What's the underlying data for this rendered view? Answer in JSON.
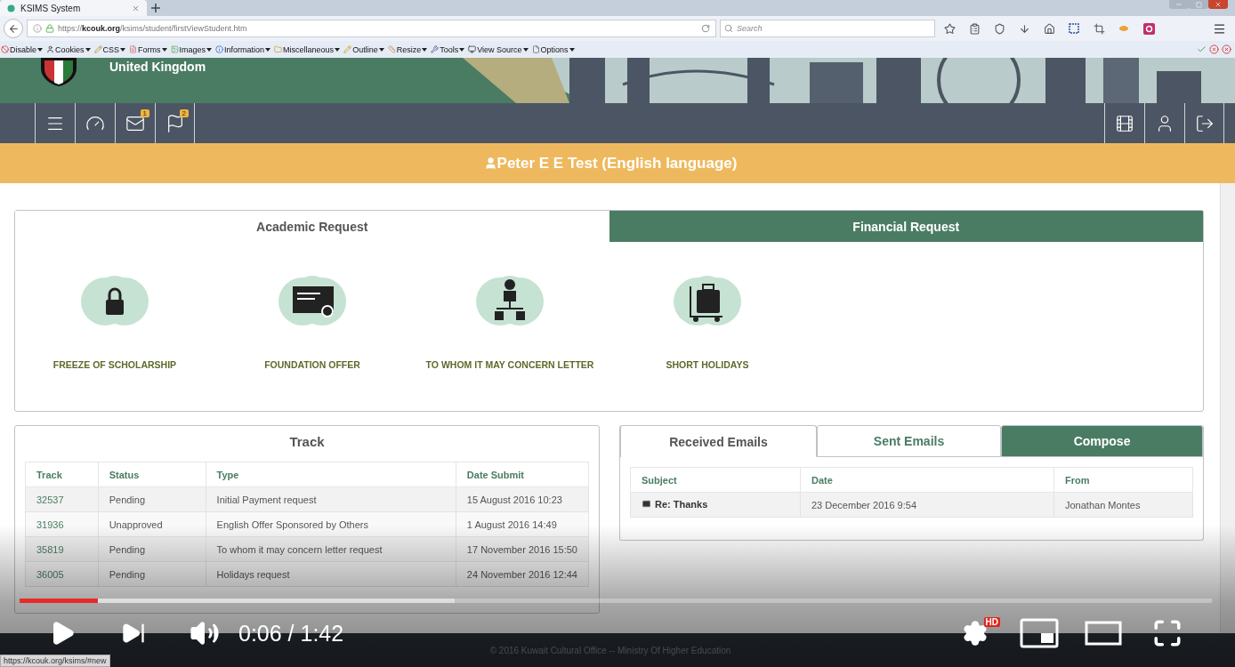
{
  "browser": {
    "tab_title": "KSIMS System",
    "url_scheme": "https://",
    "url_host": "kcouk.org",
    "url_path": "/ksims/student/firstViewStudent.htm",
    "search_placeholder": "Search"
  },
  "dev_toolbar": [
    {
      "label": "Disable"
    },
    {
      "label": "Cookies"
    },
    {
      "label": "CSS"
    },
    {
      "label": "Forms"
    },
    {
      "label": "Images"
    },
    {
      "label": "Information"
    },
    {
      "label": "Miscellaneous"
    },
    {
      "label": "Outline"
    },
    {
      "label": "Resize"
    },
    {
      "label": "Tools"
    },
    {
      "label": "View Source"
    },
    {
      "label": "Options"
    }
  ],
  "site": {
    "region": "United Kingdom"
  },
  "nav_left": [
    {
      "kind": "menu"
    },
    {
      "kind": "dashboard"
    },
    {
      "kind": "messages",
      "badge": "1"
    },
    {
      "kind": "flags",
      "badge": "2"
    }
  ],
  "student": {
    "name": "Peter E E Test (English language)"
  },
  "request_tabs": [
    {
      "label": "Academic Request",
      "selected": true
    },
    {
      "label": "Financial Request",
      "selected": false
    }
  ],
  "requests": [
    {
      "label": "FREEZE OF SCHOLARSHIP"
    },
    {
      "label": "FOUNDATION OFFER"
    },
    {
      "label": "TO WHOM IT MAY CONCERN LETTER"
    },
    {
      "label": "SHORT HOLIDAYS"
    }
  ],
  "track": {
    "title": "Track",
    "columns": [
      "Track",
      "Status",
      "Type",
      "Date Submit"
    ],
    "rows": [
      [
        "32537",
        "Pending",
        "Initial Payment request",
        "15 August 2016 10:23"
      ],
      [
        "31936",
        "Unapproved",
        "English Offer Sponsored by Others",
        "1 August 2016 14:49"
      ],
      [
        "35819",
        "Pending",
        "To whom it may concern letter request",
        "17 November 2016 15:50"
      ],
      [
        "36005",
        "Pending",
        "Holidays request",
        "24 November 2016 12:44"
      ]
    ]
  },
  "email_tabs": [
    {
      "label": "Received Emails",
      "kind": "tab",
      "selected": true
    },
    {
      "label": "Sent Emails",
      "kind": "tab",
      "selected": false
    },
    {
      "label": "Compose",
      "kind": "action",
      "selected": false
    }
  ],
  "emails": {
    "columns": [
      "Subject",
      "Date",
      "From"
    ],
    "rows": [
      {
        "subject": "Re: Thanks",
        "date": "23 December 2016 9:54",
        "from": "Jonathan Montes"
      }
    ]
  },
  "footer": "© 2016 Kuwait Cultural Office -- Ministry Of Higher Education",
  "status_url": "https://kcouk.org/ksims/#new",
  "video": {
    "time": "0:06 / 1:42",
    "quality": "HD",
    "progress": {
      "level": 0.066
    },
    "buffer": {
      "level": 0.365
    }
  }
}
